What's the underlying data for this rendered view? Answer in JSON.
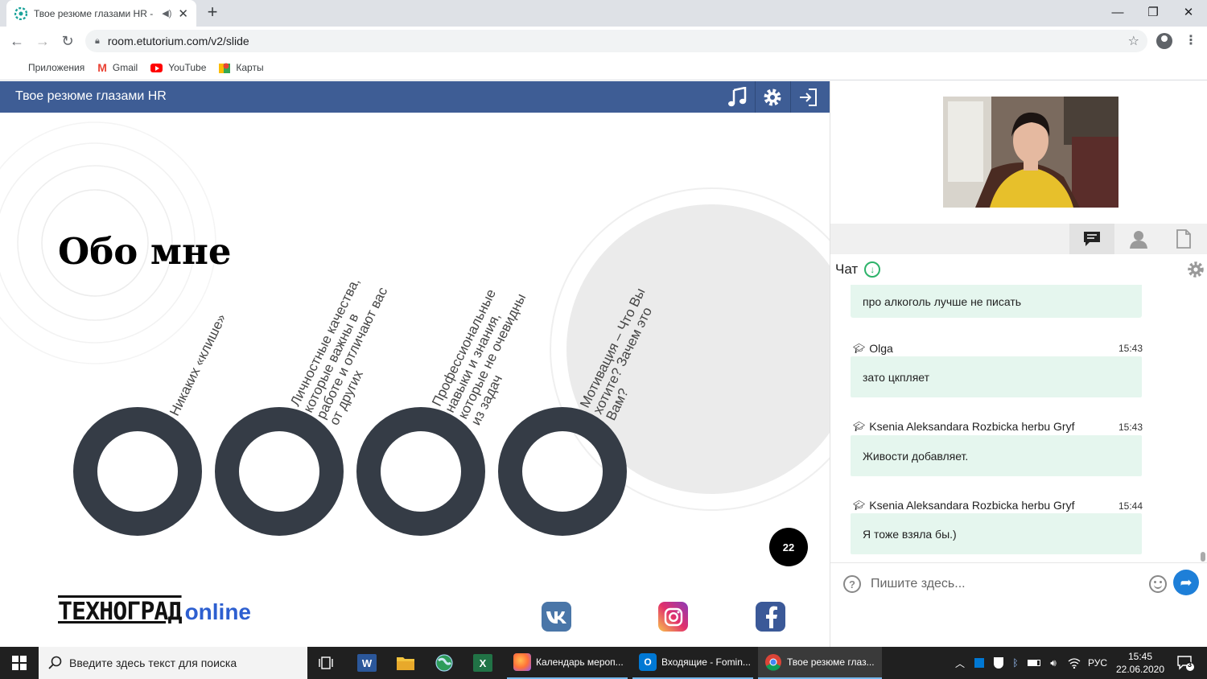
{
  "browser": {
    "tab_title": "Твое резюме глазами HR - ",
    "url": "room.etutorium.com/v2/slide",
    "bookmarks": [
      "Приложения",
      "Gmail",
      "YouTube",
      "Карты"
    ]
  },
  "app": {
    "title": "Твое резюме глазами HR"
  },
  "slide": {
    "title": "Обо мне",
    "labels": [
      "Никаких «клише»",
      "Личностные качества,\nкоторые важны в\nработе и отличают вас\nот других",
      "Профессиональные\nнавыки и знания,\nкоторые не очевидны\nиз задач",
      "Мотивация – Что Вы\nхотите? Зачем это\nВам?"
    ],
    "page_number": "22",
    "logo_main": "ТЕХНОГРАД",
    "logo_suffix": "online",
    "social": [
      "vk-icon",
      "instagram-icon",
      "facebook-icon"
    ],
    "ring_color": "#353c46"
  },
  "chat": {
    "title": "Чат",
    "messages": [
      {
        "author": "",
        "time": "",
        "text": "про алкоголь лучше не писать"
      },
      {
        "author": "Olga",
        "time": "15:43",
        "text": "зато цкпляет"
      },
      {
        "author": "Ksenia Aleksandara Rozbicka herbu Gryf",
        "time": "15:43",
        "text": "Живости добавляет."
      },
      {
        "author": "Ksenia Aleksandara Rozbicka herbu Gryf",
        "time": "15:44",
        "text": "Я тоже взяла бы.)"
      }
    ],
    "input_placeholder": "Пишите здесь..."
  },
  "taskbar": {
    "search_placeholder": "Введите здесь текст для поиска",
    "apps": [
      "Календарь мероп...",
      "Входящие - Fomin...",
      "Твое резюме глаз..."
    ],
    "lang": "РУС",
    "time": "15:45",
    "date": "22.06.2020",
    "notifications": "3"
  },
  "colors": {
    "header": "#3e5d95",
    "bubble": "#e5f6ee",
    "accent_blue": "#2d5fd0"
  }
}
